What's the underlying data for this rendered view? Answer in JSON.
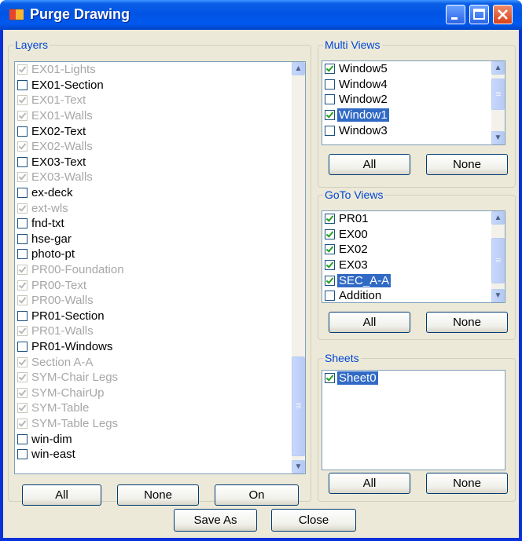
{
  "window": {
    "title": "Purge Drawing"
  },
  "layers": {
    "title": "Layers",
    "items": [
      {
        "label": "EX01-Lights",
        "checked": true,
        "disabled": true
      },
      {
        "label": "EX01-Section",
        "checked": false,
        "disabled": false
      },
      {
        "label": "EX01-Text",
        "checked": true,
        "disabled": true
      },
      {
        "label": "EX01-Walls",
        "checked": true,
        "disabled": true
      },
      {
        "label": "EX02-Text",
        "checked": false,
        "disabled": false
      },
      {
        "label": "EX02-Walls",
        "checked": true,
        "disabled": true
      },
      {
        "label": "EX03-Text",
        "checked": false,
        "disabled": false
      },
      {
        "label": "EX03-Walls",
        "checked": true,
        "disabled": true
      },
      {
        "label": "ex-deck",
        "checked": false,
        "disabled": false
      },
      {
        "label": "ext-wls",
        "checked": true,
        "disabled": true
      },
      {
        "label": "fnd-txt",
        "checked": false,
        "disabled": false
      },
      {
        "label": "hse-gar",
        "checked": false,
        "disabled": false
      },
      {
        "label": "photo-pt",
        "checked": false,
        "disabled": false
      },
      {
        "label": "PR00-Foundation",
        "checked": true,
        "disabled": true
      },
      {
        "label": "PR00-Text",
        "checked": true,
        "disabled": true
      },
      {
        "label": "PR00-Walls",
        "checked": true,
        "disabled": true
      },
      {
        "label": "PR01-Section",
        "checked": false,
        "disabled": false
      },
      {
        "label": "PR01-Walls",
        "checked": true,
        "disabled": true
      },
      {
        "label": "PR01-Windows",
        "checked": false,
        "disabled": false
      },
      {
        "label": "Section A-A",
        "checked": true,
        "disabled": true
      },
      {
        "label": "SYM-Chair Legs",
        "checked": true,
        "disabled": true
      },
      {
        "label": "SYM-ChairUp",
        "checked": true,
        "disabled": true
      },
      {
        "label": "SYM-Table",
        "checked": true,
        "disabled": true
      },
      {
        "label": "SYM-Table Legs",
        "checked": true,
        "disabled": true
      },
      {
        "label": "win-dim",
        "checked": false,
        "disabled": false
      },
      {
        "label": "win-east",
        "checked": false,
        "disabled": false
      }
    ],
    "buttons": {
      "all": "All",
      "none": "None",
      "on": "On"
    }
  },
  "multi_views": {
    "title": "Multi Views",
    "items": [
      {
        "label": "Window5",
        "checked": true,
        "selected": false
      },
      {
        "label": "Window4",
        "checked": false,
        "selected": false
      },
      {
        "label": "Window2",
        "checked": false,
        "selected": false
      },
      {
        "label": "Window1",
        "checked": true,
        "selected": true
      },
      {
        "label": "Window3",
        "checked": false,
        "selected": false
      }
    ],
    "buttons": {
      "all": "All",
      "none": "None"
    }
  },
  "goto_views": {
    "title": "GoTo Views",
    "items": [
      {
        "label": "PR01",
        "checked": true,
        "selected": false
      },
      {
        "label": "EX00",
        "checked": true,
        "selected": false
      },
      {
        "label": "EX02",
        "checked": true,
        "selected": false
      },
      {
        "label": "EX03",
        "checked": true,
        "selected": false
      },
      {
        "label": "SEC_A-A",
        "checked": true,
        "selected": true
      },
      {
        "label": "Addition",
        "checked": false,
        "selected": false
      }
    ],
    "buttons": {
      "all": "All",
      "none": "None"
    }
  },
  "sheets": {
    "title": "Sheets",
    "items": [
      {
        "label": "Sheet0",
        "checked": true,
        "selected": true
      }
    ],
    "buttons": {
      "all": "All",
      "none": "None"
    }
  },
  "footer": {
    "save_as": "Save As",
    "close": "Close"
  },
  "colors": {
    "title_bar": "#0054e3",
    "selection": "#316ac5",
    "group_title": "#0046d5",
    "face": "#ece9d8"
  }
}
